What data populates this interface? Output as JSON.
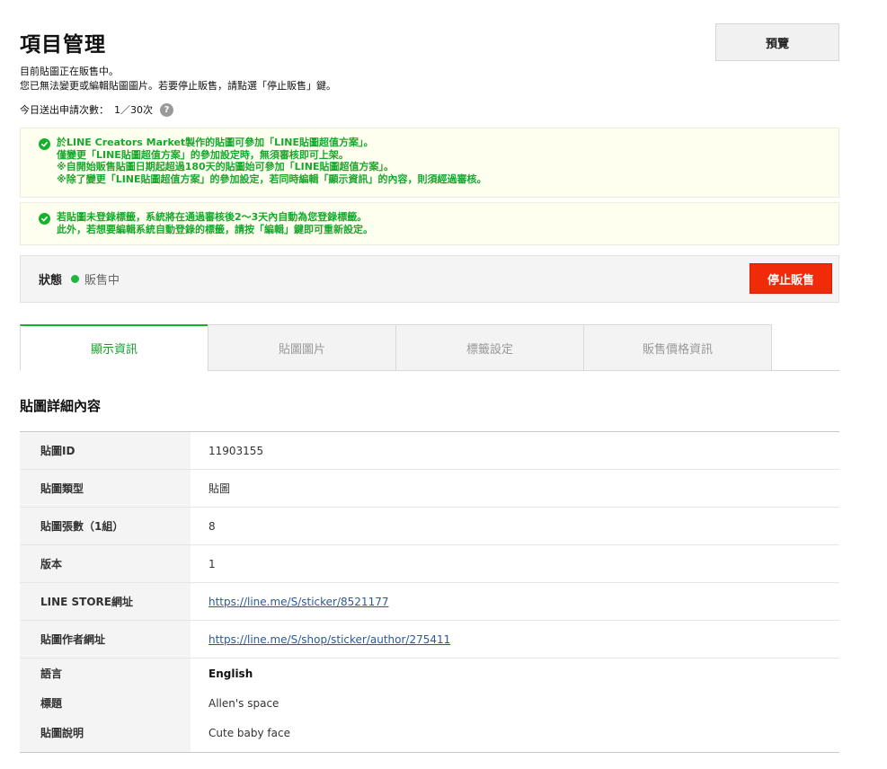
{
  "header": {
    "title": "項目管理",
    "preview_label": "預覽"
  },
  "intro": {
    "line1": "目前貼圖正在販售中。",
    "line2": "您已無法變更或編輯貼圖圖片。若要停止販售，請點選「停止販售」鍵。"
  },
  "quota": {
    "label": "今日送出申請次數：",
    "value": "1／30次",
    "help_icon": "question-circle-icon"
  },
  "notices": [
    {
      "icon": "check-circle-icon",
      "lines": [
        "於LINE Creators Market製作的貼圖可參加「LINE貼圖超值方案」。",
        "僅變更「LINE貼圖超值方案」的參加設定時，無須審核即可上架。",
        "※自開始販售貼圖日期起超過180天的貼圖始可參加「LINE貼圖超值方案」。",
        "※除了變更「LINE貼圖超值方案」的參加設定，若同時編輯「顯示資訊」的內容，則須經過審核。"
      ]
    },
    {
      "icon": "check-circle-icon",
      "lines": [
        "若貼圖未登錄標籤，系統將在通過審核後2～3天內自動為您登錄標籤。",
        "此外，若想要編輯系統自動登錄的標籤，請按「編輯」鍵即可重新設定。"
      ]
    }
  ],
  "status": {
    "label": "狀態",
    "value": "販售中",
    "stop_label": "停止販售",
    "dot_color": "#1db83a"
  },
  "tabs": [
    {
      "label": "顯示資訊",
      "active": true
    },
    {
      "label": "貼圖圖片",
      "active": false
    },
    {
      "label": "標籤設定",
      "active": false
    },
    {
      "label": "販售價格資訊",
      "active": false
    }
  ],
  "details": {
    "title": "貼圖詳細內容",
    "rows": [
      {
        "label": "貼圖ID",
        "value": "11903155"
      },
      {
        "label": "貼圖類型",
        "value": "貼圖"
      },
      {
        "label": "貼圖張數（1組）",
        "value": "8"
      },
      {
        "label": "版本",
        "value": "1"
      },
      {
        "label": "LINE STORE網址",
        "value": "https://line.me/S/sticker/8521177"
      },
      {
        "label": "貼圖作者網址",
        "value": "https://line.me/S/shop/sticker/author/275411"
      }
    ],
    "language": {
      "label": "語言",
      "value": "English",
      "title_label": "標題",
      "title_value": "Allen's space",
      "desc_label": "貼圖說明",
      "desc_value": "Cute baby face"
    }
  },
  "colors": {
    "accent_green": "#19b02c",
    "notice_text": "#17a82c",
    "stop_red": "#f12a0a",
    "link_blue": "#2a5a9c"
  }
}
